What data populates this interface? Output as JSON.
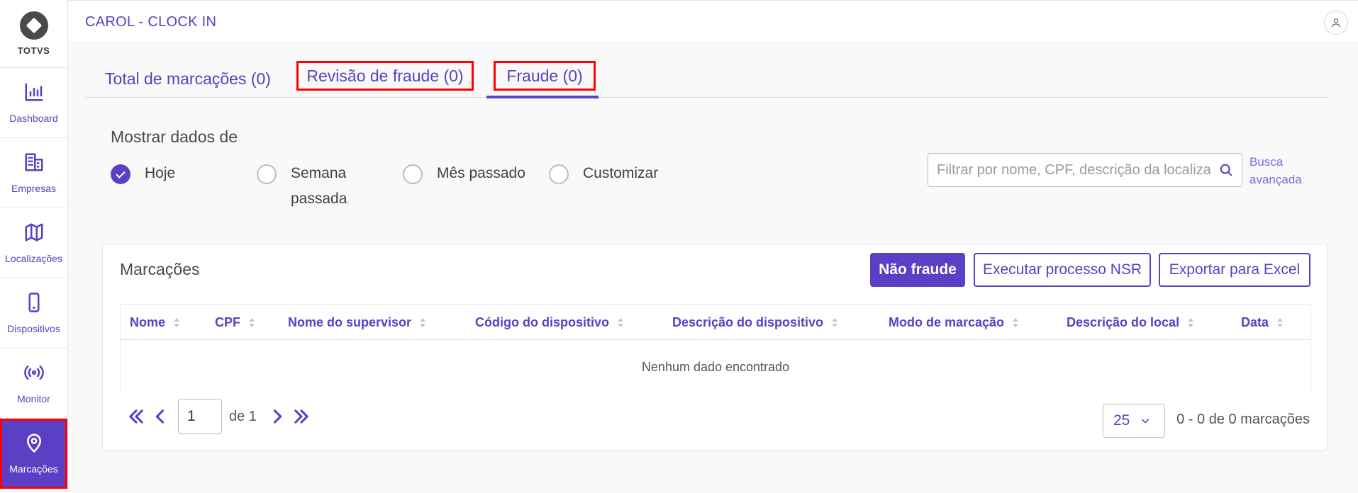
{
  "sidebar": {
    "logo_text": "TOTVS",
    "items": [
      {
        "label": "Dashboard",
        "icon": "bar-chart-icon"
      },
      {
        "label": "Empresas",
        "icon": "building-icon"
      },
      {
        "label": "Localizações",
        "icon": "map-icon"
      },
      {
        "label": "Dispositivos",
        "icon": "smartphone-icon"
      },
      {
        "label": "Monitor",
        "icon": "broadcast-icon"
      },
      {
        "label": "Marcações",
        "icon": "map-pin-icon",
        "active": true
      }
    ]
  },
  "header": {
    "title": "CAROL - CLOCK IN",
    "user_icon": "user-icon"
  },
  "tabs": [
    {
      "label": "Total de marcações (0)"
    },
    {
      "label": "Revisão de fraude (0)"
    },
    {
      "label": "Fraude (0)",
      "active": true
    }
  ],
  "filters": {
    "title": "Mostrar dados de",
    "options": [
      {
        "label": "Hoje",
        "checked": true
      },
      {
        "label": "Semana passada",
        "checked": false
      },
      {
        "label": "Mês passado",
        "checked": false
      },
      {
        "label": "Customizar",
        "checked": false
      }
    ],
    "search_placeholder": "Filtrar por nome, CPF, descrição da localização",
    "advanced_search": "Busca avançada"
  },
  "card": {
    "title": "Marcações",
    "buttons": {
      "not_fraud": "Não fraude",
      "nsr": "Executar processo NSR",
      "excel": "Exportar para Excel"
    },
    "columns": [
      "Nome",
      "CPF",
      "Nome do supervisor",
      "Código do dispositivo",
      "Descrição do dispositivo",
      "Modo de marcação",
      "Descrição do local",
      "Data"
    ],
    "empty_text": "Nenhum dado encontrado",
    "pagination": {
      "current_page": "1",
      "of_label": "de 1",
      "per_page": "25",
      "range": "0 - 0 de 0 marcações"
    }
  },
  "colors": {
    "accent": "#5b3fc4",
    "highlight": "#ff0000"
  }
}
